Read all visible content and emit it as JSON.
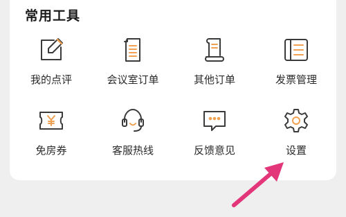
{
  "section": {
    "title": "常用工具"
  },
  "tools": [
    {
      "label": "我的点评",
      "icon": "edit-square-icon"
    },
    {
      "label": "会议室订单",
      "icon": "document-list-icon"
    },
    {
      "label": "其他订单",
      "icon": "scroll-order-icon"
    },
    {
      "label": "发票管理",
      "icon": "invoice-list-icon"
    },
    {
      "label": "免房券",
      "icon": "yuan-coupon-icon"
    },
    {
      "label": "客服热线",
      "icon": "headset-icon"
    },
    {
      "label": "反馈意见",
      "icon": "chat-bubble-icon"
    },
    {
      "label": "设置",
      "icon": "gear-icon"
    }
  ],
  "colors": {
    "icon_stroke": "#3a3a3a",
    "accent": "#f0a050",
    "arrow": "#e2357a",
    "card": "#ffffff",
    "background": "#efefef"
  }
}
